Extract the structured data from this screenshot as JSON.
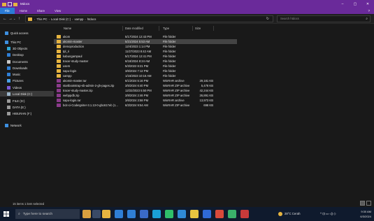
{
  "window": {
    "title": "Mdocs",
    "controls": [
      "–",
      "▢",
      "✕"
    ]
  },
  "ribbon": {
    "tabs": [
      "File",
      "Home",
      "Share",
      "View"
    ],
    "active": "File",
    "help_glyph": "?"
  },
  "address": {
    "crumbs": [
      "This PC",
      "Local Disk (C:)",
      "xampp",
      "htdocs"
    ],
    "search_placeholder": "Search htdocs"
  },
  "sidebar": {
    "items": [
      {
        "label": "Quick access",
        "icon": "star-icon",
        "color": "#3d8fe0",
        "selected": false
      },
      {
        "label": "This PC",
        "icon": "computer-icon",
        "color": "#3d8fe0",
        "selected": false
      },
      {
        "label": "3D Objects",
        "icon": "cube-icon",
        "color": "#2fa6d8",
        "selected": false
      },
      {
        "label": "Desktop",
        "icon": "desktop-icon",
        "color": "#2f7fd6",
        "selected": false
      },
      {
        "label": "Documents",
        "icon": "document-icon",
        "color": "#c8c8c8",
        "selected": false
      },
      {
        "label": "Downloads",
        "icon": "download-icon",
        "color": "#2f7fd6",
        "selected": false
      },
      {
        "label": "Music",
        "icon": "music-icon",
        "color": "#2f7fd6",
        "selected": false
      },
      {
        "label": "Pictures",
        "icon": "picture-icon",
        "color": "#4aa0e6",
        "selected": false
      },
      {
        "label": "Videos",
        "icon": "video-icon",
        "color": "#7a5ad6",
        "selected": false
      },
      {
        "label": "Local Disk (C:)",
        "icon": "drive-icon",
        "color": "#9ab4c8",
        "selected": true
      },
      {
        "label": "FILE (D:)",
        "icon": "drive-icon",
        "color": "#9a9a9a",
        "selected": false
      },
      {
        "label": "DATA (E:)",
        "icon": "drive-icon",
        "color": "#9a9a9a",
        "selected": false
      },
      {
        "label": "HIBURAN (F:)",
        "icon": "drive-icon",
        "color": "#9a9a9a",
        "selected": false
      },
      {
        "label": "Network",
        "icon": "network-icon",
        "color": "#3d8fe0",
        "selected": false
      }
    ]
  },
  "columns": [
    "Name",
    "Date modified",
    "Type",
    "Size"
  ],
  "files": [
    {
      "name": "akom",
      "date": "5/17/2024 12:43 PM",
      "type": "File folder",
      "size": "",
      "kind": "folder",
      "selected": false
    },
    {
      "name": "akomin-master",
      "date": "5/21/2024 5:53 AM",
      "type": "File folder",
      "size": "",
      "kind": "folder",
      "selected": true
    },
    {
      "name": "demoproduction",
      "date": "12/4/2023 1:14 PM",
      "type": "File folder",
      "size": "",
      "kind": "folder",
      "selected": false
    },
    {
      "name": "tpl_ri",
      "date": "11/27/2023 8:42 AM",
      "type": "File folder",
      "size": "",
      "kind": "folder",
      "selected": false
    },
    {
      "name": "kabungampaul",
      "date": "5/17/2024 12:41 PM",
      "type": "File folder",
      "size": "",
      "kind": "folder",
      "selected": false
    },
    {
      "name": "tracer-study-master",
      "date": "6/18/2024 8:24 AM",
      "type": "File folder",
      "size": "",
      "kind": "folder",
      "selected": false
    },
    {
      "name": "users",
      "date": "5/3/2022 8:21 PM",
      "type": "File folder",
      "size": "",
      "kind": "folder",
      "selected": false
    },
    {
      "name": "sapu-login",
      "date": "3/6/2024 7:12 PM",
      "type": "File folder",
      "size": "",
      "kind": "folder",
      "selected": false
    },
    {
      "name": "xampp",
      "date": "1/15/2023 10:16 AM",
      "type": "File folder",
      "size": "",
      "kind": "folder",
      "selected": false
    },
    {
      "name": "akomin-master.rar",
      "date": "6/1/2024 5:16 PM",
      "type": "WinRAR archive",
      "size": "29,181 KB",
      "kind": "archive",
      "selected": false
    },
    {
      "name": "startbootstrap-sb-admin-2-gh-pages.zip",
      "date": "3/5/2024 6:40 PM",
      "type": "WinRAR ZIP archive",
      "size": "5,478 KB",
      "kind": "archive",
      "selected": false
    },
    {
      "name": "tracer-study-master.zip",
      "date": "12/22/2023 5:50 PM",
      "type": "WinRAR ZIP archive",
      "size": "42,244 KB",
      "kind": "archive",
      "selected": false
    },
    {
      "name": "webppdb.zip",
      "date": "3/8/2024 2:46 PM",
      "type": "WinRAR ZIP archive",
      "size": "26,891 KB",
      "kind": "archive",
      "selected": false
    },
    {
      "name": "sapu-login.rar",
      "date": "3/6/2024 3:58 PM",
      "type": "WinRAR archive",
      "size": "13,973 KB",
      "kind": "archive",
      "selected": false
    },
    {
      "name": "bcit-ci-CodeIgniter-3.1.13-0-gbc617eb (1...",
      "date": "6/3/2024 9:54 AM",
      "type": "WinRAR ZIP archive",
      "size": "698 KB",
      "kind": "archive",
      "selected": false
    }
  ],
  "status": {
    "text": "15 items   1 item selected"
  },
  "taskbar": {
    "search_placeholder": "Type here to search",
    "apps": [
      {
        "icon": "people-icon",
        "color": "#d8a040"
      },
      {
        "icon": "task-view-icon",
        "color": "#3a4a66"
      },
      {
        "icon": "file-explorer-icon",
        "color": "#e6b440"
      },
      {
        "icon": "app-icon",
        "color": "#2f7fd6"
      },
      {
        "icon": "mail-icon",
        "color": "#2f7fd6"
      },
      {
        "icon": "store-icon",
        "color": "#3a6ac8"
      },
      {
        "icon": "edge-icon",
        "color": "#1aa0d8"
      },
      {
        "icon": "whatsapp-icon",
        "color": "#2fbf6a"
      },
      {
        "icon": "vscode-icon",
        "color": "#2f8ad6"
      },
      {
        "icon": "chrome-icon",
        "color": "#e6c440"
      },
      {
        "icon": "app-icon",
        "color": "#2f6ad6"
      },
      {
        "icon": "app-icon",
        "color": "#d84a3a"
      },
      {
        "icon": "app-icon",
        "color": "#3ab06a"
      },
      {
        "icon": "app-icon",
        "color": "#c83a3a"
      }
    ],
    "weather": "28°C Cerah",
    "tray_glyphs": "^  ⊡  ▭  ◁)  ◇",
    "time": "9:30 AM",
    "date": "6/3/2024"
  }
}
